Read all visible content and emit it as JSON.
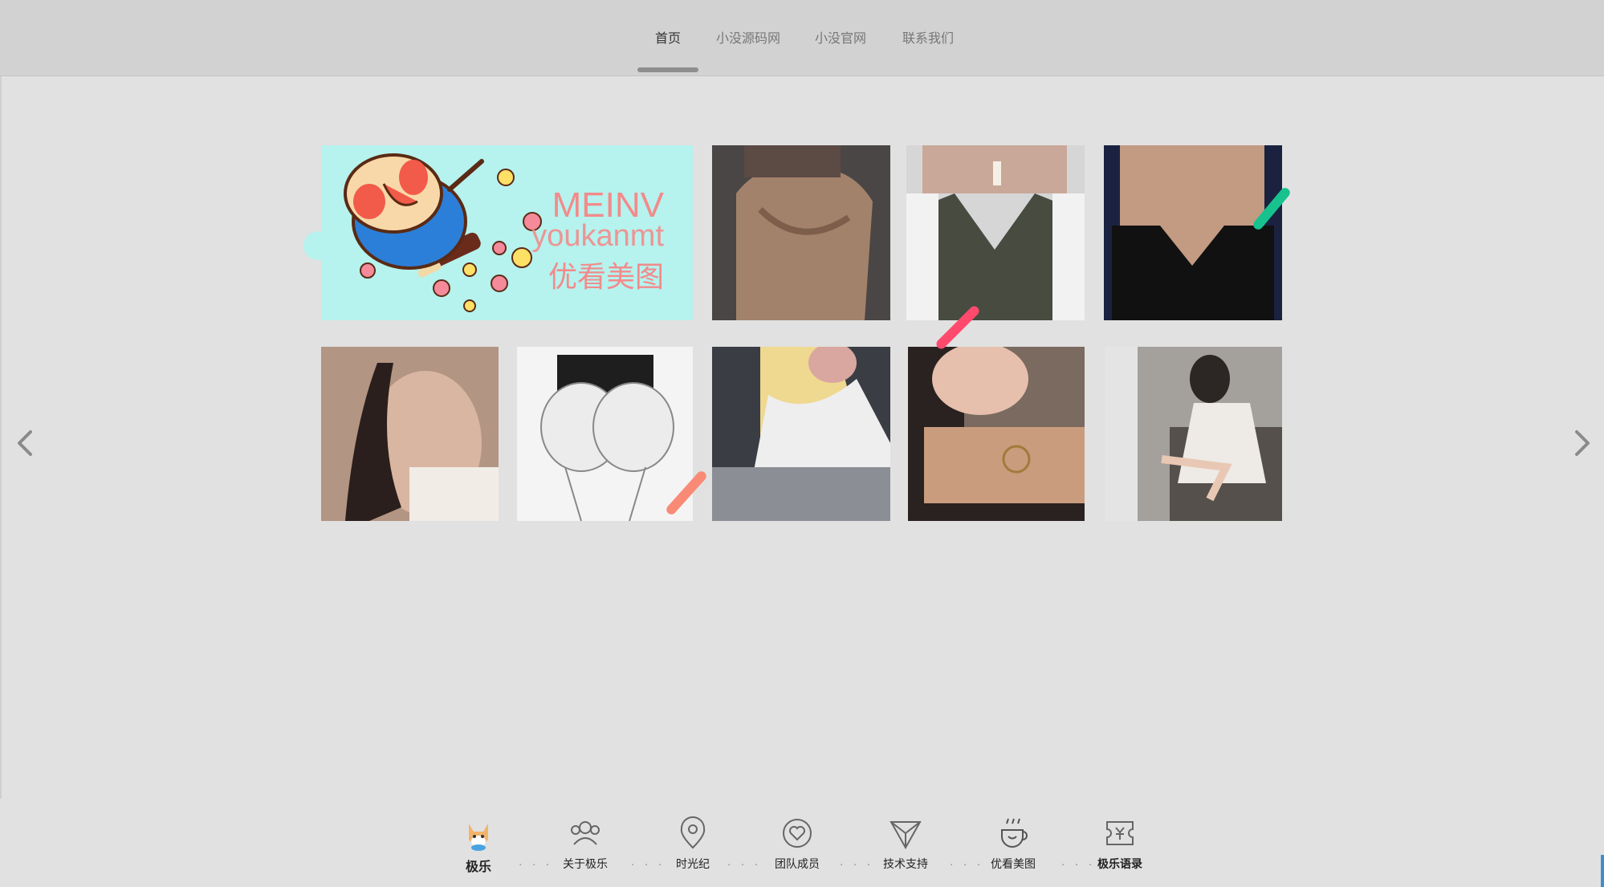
{
  "nav": {
    "items": [
      {
        "label": "首页",
        "active": true
      },
      {
        "label": "小没源码网",
        "active": false
      },
      {
        "label": "小没官网",
        "active": false
      },
      {
        "label": "联系我们",
        "active": false
      }
    ]
  },
  "feature": {
    "line1": "MEINV",
    "line2": "youkanmt",
    "line3": "优看美图"
  },
  "carousel": {
    "prev_icon": "chevron-left-icon",
    "next_icon": "chevron-right-icon"
  },
  "footer": {
    "items": [
      {
        "label": "极乐",
        "icon": "shiba-dog-icon",
        "active": true
      },
      {
        "label": "关于极乐",
        "icon": "people-icon",
        "active": false
      },
      {
        "label": "时光纪",
        "icon": "location-pin-icon",
        "active": false
      },
      {
        "label": "团队成员",
        "icon": "heart-chat-icon",
        "active": false
      },
      {
        "label": "技术支持",
        "icon": "paper-plane-icon",
        "active": false
      },
      {
        "label": "优看美图",
        "icon": "coffee-cup-icon",
        "active": false
      },
      {
        "label": "极乐语录",
        "icon": "ticket-icon",
        "active": false
      }
    ],
    "separator": "· · ·"
  },
  "colors": {
    "accent_green": "#17c28e",
    "accent_pink": "#ff4a6e",
    "accent_salmon": "#f98a76",
    "feature_bg": "#b6f2ee",
    "feature_text": "#f28b8b"
  }
}
